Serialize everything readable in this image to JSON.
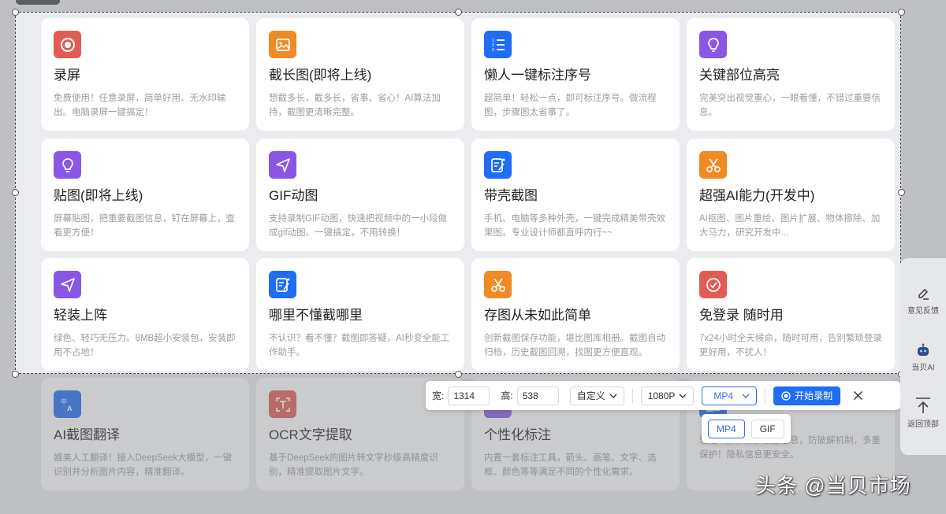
{
  "cards": [
    {
      "title": "录屏",
      "desc": "免费使用！任意录屏，简单好用、无水印输出。电脑录屏一键搞定！",
      "icon": "record-icon",
      "color": "#e25b55"
    },
    {
      "title": "截长图(即将上线)",
      "desc": "想截多长，截多长，省事、省心！AI算法加持，截图更清晰完整。",
      "icon": "image-icon",
      "color": "#f08a24"
    },
    {
      "title": "懒人一键标注序号",
      "desc": "超简单！轻松一点，即可标注序号。做流程图，步骤图太省事了。",
      "icon": "numbered-list-icon",
      "color": "#1f6df2"
    },
    {
      "title": "关键部位高亮",
      "desc": "完美突出视觉重心，一眼看懂，不错过重要信息。",
      "icon": "bulb-icon",
      "color": "#8a56e6"
    },
    {
      "title": "贴图(即将上线)",
      "desc": "屏幕贴图，把重要截图信息，钉在屏幕上，查看更方便！",
      "icon": "bulb-icon",
      "color": "#8a56e6"
    },
    {
      "title": "GIF动图",
      "desc": "支持录制GIF动图，快速把视频中的一小段做成gif动图。一键搞定，不用转换！",
      "icon": "send-icon",
      "color": "#8a56e6"
    },
    {
      "title": "带壳截图",
      "desc": "手机、电脑等多种外壳，一键完成精美带壳效果图。专业设计师都直呼内行~~",
      "icon": "edit-doc-icon",
      "color": "#1f6df2"
    },
    {
      "title": "超强AI能力(开发中)",
      "desc": "AI抠图、图片重绘、图片扩展、物体擦除、加大马力，研究开发中...",
      "icon": "scissors-icon",
      "color": "#f08a24"
    },
    {
      "title": "轻装上阵",
      "desc": "绿色、轻巧无压力。8MB超小安装包，安装即用不占地！",
      "icon": "send-icon",
      "color": "#8a56e6"
    },
    {
      "title": "哪里不懂截哪里",
      "desc": "不认识？看不懂？截图即答疑，AI秒变全能工作助手。",
      "icon": "edit-doc-icon",
      "color": "#1f6df2"
    },
    {
      "title": "存图从未如此简单",
      "desc": "创新截图保存功能，堪比图库相册。截图自动归档，历史截图回溯，找图更方便直观。",
      "icon": "scissors-icon",
      "color": "#f08a24"
    },
    {
      "title": "免登录 随时用",
      "desc": "7x24小时全天候命，随时可用，告别繁琐登录更好用，不扰人！",
      "icon": "check-circle-icon",
      "color": "#e25b55"
    },
    {
      "title": "AI截图翻译",
      "desc": "媲美人工翻译！接入DeepSeek大模型，一键识别并分析图片内容，精准翻译。",
      "icon": "translate-icon",
      "color": "#1f6df2"
    },
    {
      "title": "OCR文字提取",
      "desc": "基于DeepSeek的图片转文字秒级高精度识别，精准提取图片文字。",
      "icon": "ocr-icon",
      "color": "#e25b55"
    },
    {
      "title": "个性化标注",
      "desc": "内置一套标注工具，箭头、画笔、文字、选框、颜色等等满足不同的个性化需求。",
      "icon": "annotate-icon",
      "color": "#8a56e6"
    },
    {
      "title": "",
      "desc": "轻轻一抹，保护敏感信息，防破解机制，多重保护！隐私信息更安全。",
      "icon": "mosaic-icon",
      "color": "#1f6df2"
    }
  ],
  "toolbar": {
    "width_label": "宽:",
    "width_value": "1314",
    "height_label": "高:",
    "height_value": "538",
    "size_mode": "自定义",
    "resolution": "1080P",
    "format": "MP4",
    "start_label": "开始录制"
  },
  "format_options": [
    "MP4",
    "GIF"
  ],
  "sidebar": {
    "feedback": "意见反馈",
    "ai": "当贝AI",
    "top": "返回顶部"
  },
  "watermark": "头条 @当贝市场"
}
